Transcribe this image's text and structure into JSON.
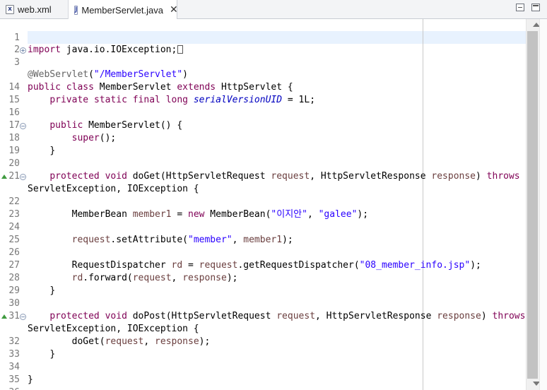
{
  "tabs": [
    {
      "label": "web.xml",
      "icon": "xml-file-icon",
      "icon_glyph": "x",
      "active": false
    },
    {
      "label": "MemberServlet.java",
      "icon": "java-file-icon",
      "icon_glyph": "J",
      "active": true,
      "close_glyph": "✕"
    }
  ],
  "window_controls": {
    "minimize": "minimize-icon",
    "maximize": "maximize-icon"
  },
  "editor": {
    "colors": {
      "keyword": "#7f0055",
      "string": "#2a00ff",
      "annotation": "#646464",
      "field": "#0000c0",
      "parameter": "#6a3e3e",
      "line_highlight": "#e8f2fe"
    },
    "lines": {
      "l1": {
        "num": "1"
      },
      "l2": {
        "num": "2"
      },
      "l3": {
        "num": "3",
        "kw_import": "import",
        "rest": " java.io.IOException;",
        "fold": "+"
      },
      "l14": {
        "num": "14",
        "ann": "@WebServlet",
        "p1": "(",
        "str": "\"/MemberServlet\"",
        "p2": ")"
      },
      "l15": {
        "num": "15",
        "kw1": "public",
        "kw2": "class",
        "name": " MemberServlet ",
        "kw3": "extends",
        "rest": " HttpServlet {"
      },
      "l16": {
        "num": "16",
        "kw1": "private",
        "kw2": "static",
        "kw3": "final",
        "kw4": "long",
        "field": "serialVersionUID",
        "rest": " = 1L;"
      },
      "l17": {
        "num": "17"
      },
      "l18": {
        "num": "18",
        "kw1": "public",
        "rest": " MemberServlet() {",
        "fold": "−"
      },
      "l19": {
        "num": "19",
        "kw1": "super",
        "rest": "();"
      },
      "l20": {
        "num": "20",
        "rest": "}"
      },
      "l21": {
        "num": "21"
      },
      "l22": {
        "num": "22",
        "fold": "−",
        "kw1": "protected",
        "kw2": "void",
        "a": " doGet(HttpServletRequest ",
        "p1": "request",
        "b": ", HttpServletResponse ",
        "p2": "response",
        "c": ") ",
        "kw3": "throws"
      },
      "l22b": {
        "rest": "ServletException, IOException {"
      },
      "l23": {
        "num": "23"
      },
      "l24": {
        "num": "24",
        "a": "MemberBean ",
        "p1": "member1",
        "b": " = ",
        "kw1": "new",
        "c": " MemberBean(",
        "s1": "\"이지안\"",
        "d": ", ",
        "s2": "\"galee\"",
        "e": ");"
      },
      "l25": {
        "num": "25"
      },
      "l26": {
        "num": "26",
        "p1": "request",
        "a": ".setAttribute(",
        "s1": "\"member\"",
        "b": ", ",
        "p2": "member1",
        "c": ");"
      },
      "l27": {
        "num": "27"
      },
      "l28": {
        "num": "28",
        "a": "RequestDispatcher ",
        "p1": "rd",
        "b": " = ",
        "p2": "request",
        "c": ".getRequestDispatcher(",
        "s1": "\"08_member_info.jsp\"",
        "d": ");"
      },
      "l29": {
        "num": "29",
        "p1": "rd",
        "a": ".forward(",
        "p2": "request",
        "b": ", ",
        "p3": "response",
        "c": ");"
      },
      "l30": {
        "num": "30",
        "rest": "}"
      },
      "l31": {
        "num": "31"
      },
      "l32": {
        "num": "32",
        "fold": "−",
        "kw1": "protected",
        "kw2": "void",
        "a": " doPost(HttpServletRequest ",
        "p1": "request",
        "b": ", HttpServletResponse ",
        "p2": "response",
        "c": ") ",
        "kw3": "throws"
      },
      "l32b": {
        "rest": "ServletException, IOException {"
      },
      "l33": {
        "num": "33",
        "a": "doGet(",
        "p1": "request",
        "b": ", ",
        "p2": "response",
        "c": ");"
      },
      "l34": {
        "num": "34",
        "rest": "}"
      },
      "l35": {
        "num": "35"
      },
      "l36": {
        "num": "36",
        "rest": "}"
      }
    }
  }
}
